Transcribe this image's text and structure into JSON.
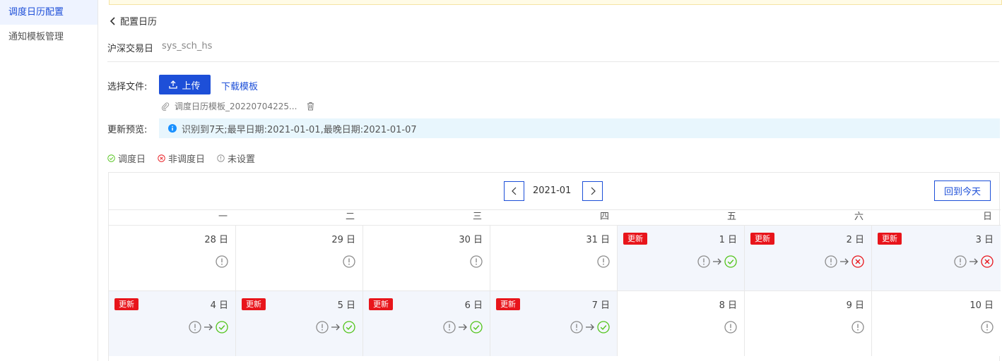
{
  "sidebar": {
    "items": [
      {
        "label": "调度日历配置",
        "active": true
      },
      {
        "label": "通知模板管理",
        "active": false
      }
    ]
  },
  "header": {
    "back_label": "配置日历"
  },
  "calendar_info": {
    "name_label": "沪深交易日",
    "name_value": "sys_sch_hs"
  },
  "upload": {
    "file_label": "选择文件:",
    "upload_button": "上传",
    "download_link": "下载模板",
    "file_name": "调度日历模板_20220704225..."
  },
  "preview": {
    "label": "更新预览:",
    "info_text": "识别到7天;最早日期:2021-01-01,最晚日期:2021-01-07"
  },
  "legend": {
    "scheduled": "调度日",
    "not_scheduled": "非调度日",
    "unset": "未设置"
  },
  "calendar": {
    "month": "2021-01",
    "today_button": "回到今天",
    "weekdays": [
      "一",
      "二",
      "三",
      "四",
      "五",
      "六",
      "日"
    ],
    "update_badge": "更新",
    "rows": [
      [
        {
          "date": "28 日",
          "updated": false,
          "from": "unset",
          "to": null
        },
        {
          "date": "29 日",
          "updated": false,
          "from": "unset",
          "to": null
        },
        {
          "date": "30 日",
          "updated": false,
          "from": "unset",
          "to": null
        },
        {
          "date": "31 日",
          "updated": false,
          "from": "unset",
          "to": null
        },
        {
          "date": "1 日",
          "updated": true,
          "from": "unset",
          "to": "scheduled"
        },
        {
          "date": "2 日",
          "updated": true,
          "from": "unset",
          "to": "not_scheduled"
        },
        {
          "date": "3 日",
          "updated": true,
          "from": "unset",
          "to": "not_scheduled"
        }
      ],
      [
        {
          "date": "4 日",
          "updated": true,
          "from": "unset",
          "to": "scheduled"
        },
        {
          "date": "5 日",
          "updated": true,
          "from": "unset",
          "to": "scheduled"
        },
        {
          "date": "6 日",
          "updated": true,
          "from": "unset",
          "to": "scheduled"
        },
        {
          "date": "7 日",
          "updated": true,
          "from": "unset",
          "to": "scheduled"
        },
        {
          "date": "8 日",
          "updated": false,
          "from": "unset",
          "to": null
        },
        {
          "date": "9 日",
          "updated": false,
          "from": "unset",
          "to": null
        },
        {
          "date": "10 日",
          "updated": false,
          "from": "unset",
          "to": null
        }
      ]
    ]
  },
  "colors": {
    "primary": "#1d4fd8",
    "scheduled": "#52c41a",
    "not_scheduled": "#e8151b",
    "unset": "#8c8c8c",
    "badge": "#e8151b",
    "updated_cell_bg": "#f3f6fc"
  }
}
